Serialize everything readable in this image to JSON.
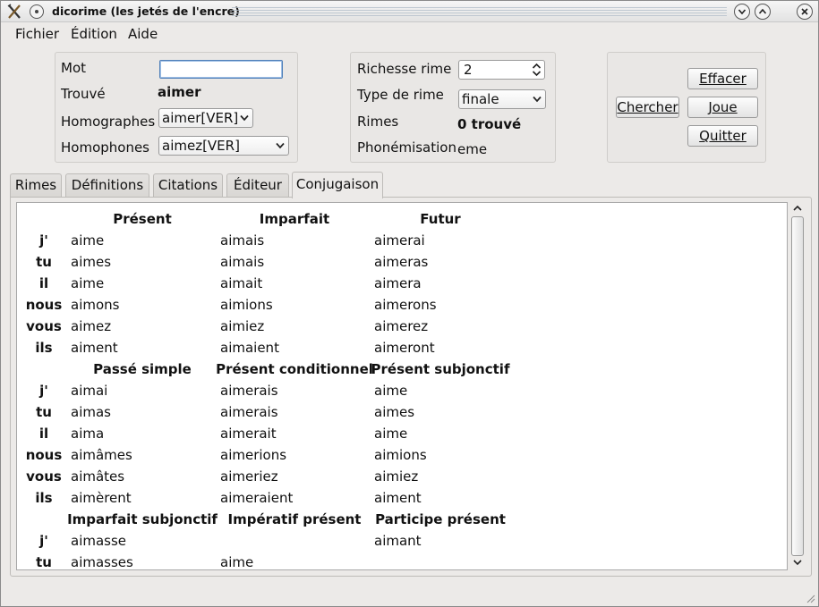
{
  "window": {
    "title": "dicorime (les jetés de l'encre)"
  },
  "menu": [
    {
      "label": "Fichier"
    },
    {
      "label": "Édition"
    },
    {
      "label": "Aide"
    }
  ],
  "search": {
    "mot_label": "Mot",
    "mot_value": "",
    "trouve_label": "Trouvé",
    "trouve_value": "aimer",
    "homographes_label": "Homographes",
    "homographes_selected": "aimer[VER]",
    "homophones_label": "Homophones",
    "homophones_selected": "aimez[VER]"
  },
  "rime": {
    "richesse_label": "Richesse rime",
    "richesse_value": "2",
    "type_label": "Type de rime",
    "type_selected": "finale",
    "rimes_label": "Rimes",
    "rimes_value": "0 trouvé",
    "phonem_label": "Phonémisation",
    "phonem_value": "eme"
  },
  "buttons": {
    "chercher": "Chercher",
    "effacer": "Effacer",
    "joue": "Joue",
    "quitter": "Quitter"
  },
  "tabs": [
    {
      "label": "Rimes"
    },
    {
      "label": "Définitions"
    },
    {
      "label": "Citations"
    },
    {
      "label": "Éditeur"
    },
    {
      "label": "Conjugaison"
    }
  ],
  "conjugaison": {
    "sections": [
      {
        "headers": [
          "Présent",
          "Imparfait",
          "Futur"
        ],
        "rows": [
          [
            "j'",
            "aime",
            "aimais",
            "aimerai"
          ],
          [
            "tu",
            "aimes",
            "aimais",
            "aimeras"
          ],
          [
            "il",
            "aime",
            "aimait",
            "aimera"
          ],
          [
            "nous",
            "aimons",
            "aimions",
            "aimerons"
          ],
          [
            "vous",
            "aimez",
            "aimiez",
            "aimerez"
          ],
          [
            "ils",
            "aiment",
            "aimaient",
            "aimeront"
          ]
        ]
      },
      {
        "headers": [
          "Passé simple",
          "Présent conditionnel",
          "Présent subjonctif"
        ],
        "rows": [
          [
            "j'",
            "aimai",
            "aimerais",
            "aime"
          ],
          [
            "tu",
            "aimas",
            "aimerais",
            "aimes"
          ],
          [
            "il",
            "aima",
            "aimerait",
            "aime"
          ],
          [
            "nous",
            "aimâmes",
            "aimerions",
            "aimions"
          ],
          [
            "vous",
            "aimâtes",
            "aimeriez",
            "aimiez"
          ],
          [
            "ils",
            "aimèrent",
            "aimeraient",
            "aiment"
          ]
        ]
      },
      {
        "headers": [
          "Imparfait subjonctif",
          "Impératif présent",
          "Participe présent"
        ],
        "rows": [
          [
            "j'",
            "aimasse",
            "",
            "aimant"
          ],
          [
            "tu",
            "aimasses",
            "aime",
            ""
          ]
        ]
      }
    ]
  }
}
